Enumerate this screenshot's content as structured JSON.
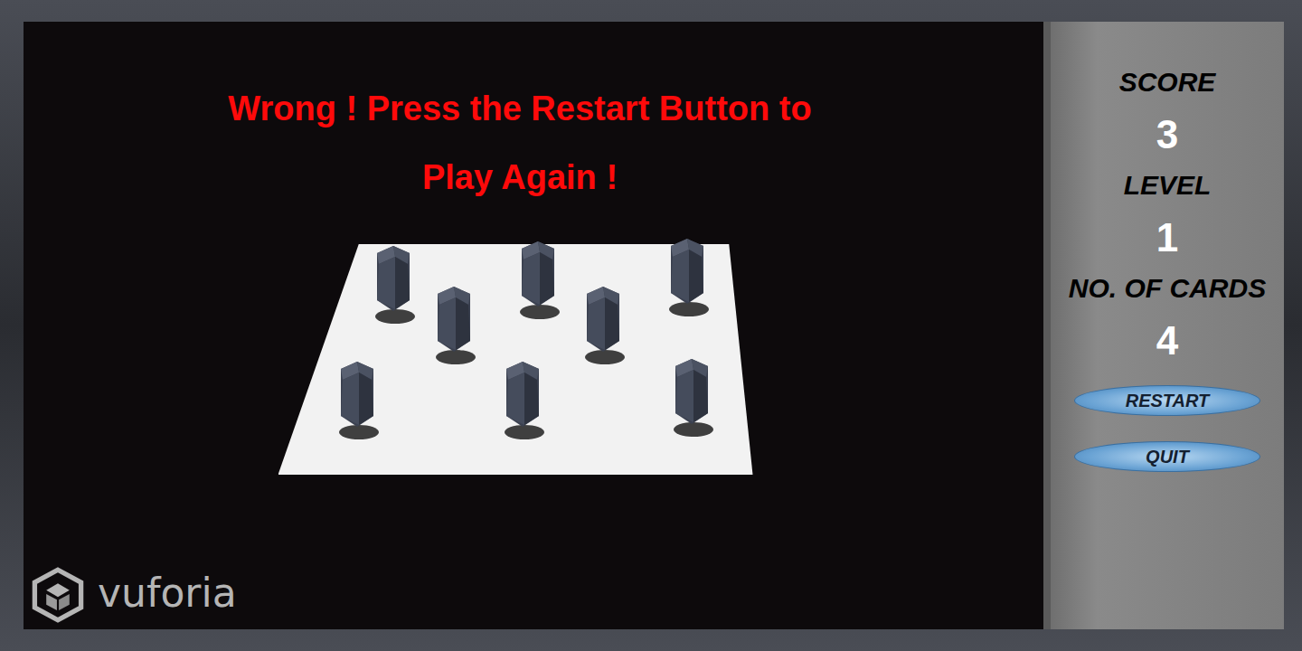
{
  "message": {
    "lines": [
      "Wrong ! Press the Restart Button to",
      "Play Again !"
    ]
  },
  "camera": {
    "watermark": "vuforia"
  },
  "stats": [
    {
      "label": "SCORE",
      "value": "3"
    },
    {
      "label": "LEVEL",
      "value": "1"
    },
    {
      "label": "NO. OF CARDS",
      "value": "4"
    }
  ],
  "buttons": [
    "RESTART",
    "QUIT"
  ]
}
